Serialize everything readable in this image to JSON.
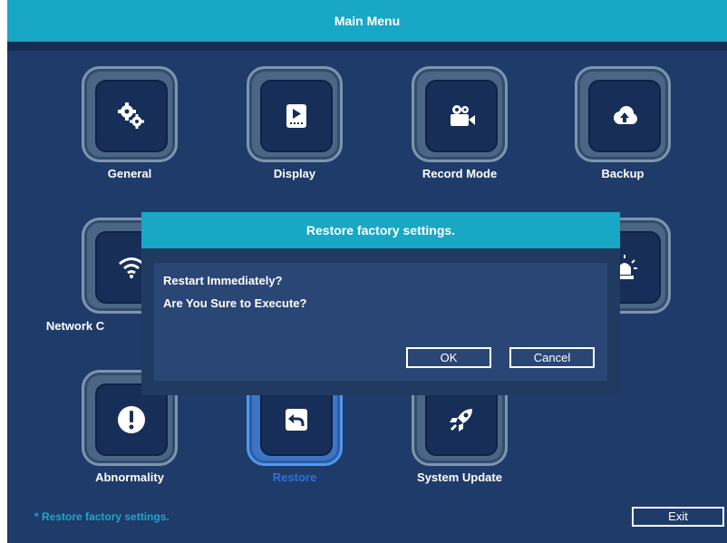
{
  "title": "Main Menu",
  "tiles": [
    {
      "label": "General",
      "icon": "gears-icon"
    },
    {
      "label": "Display",
      "icon": "display-icon"
    },
    {
      "label": "Record Mode",
      "icon": "camera-icon"
    },
    {
      "label": "Backup",
      "icon": "cloud-upload-icon"
    },
    {
      "label": "Network C",
      "icon": "wifi-icon"
    },
    {
      "label": "rm",
      "icon": "alarm-icon"
    },
    {
      "label": "Abnormality",
      "icon": "exclamation-icon"
    },
    {
      "label": "Restore",
      "icon": "restore-icon",
      "selected": true
    },
    {
      "label": "System Update",
      "icon": "rocket-icon"
    }
  ],
  "status_text": "*  Restore factory settings.",
  "exit_label": "Exit",
  "dialog": {
    "title": "Restore factory settings.",
    "line1": "Restart Immediately?",
    "line2": "Are You Sure to Execute?",
    "ok_label": "OK",
    "cancel_label": "Cancel"
  },
  "colors": {
    "header": "#18a7c4",
    "background": "#1f3b6a",
    "selected": "#2b73d6",
    "status_text": "#1aa9c8"
  }
}
